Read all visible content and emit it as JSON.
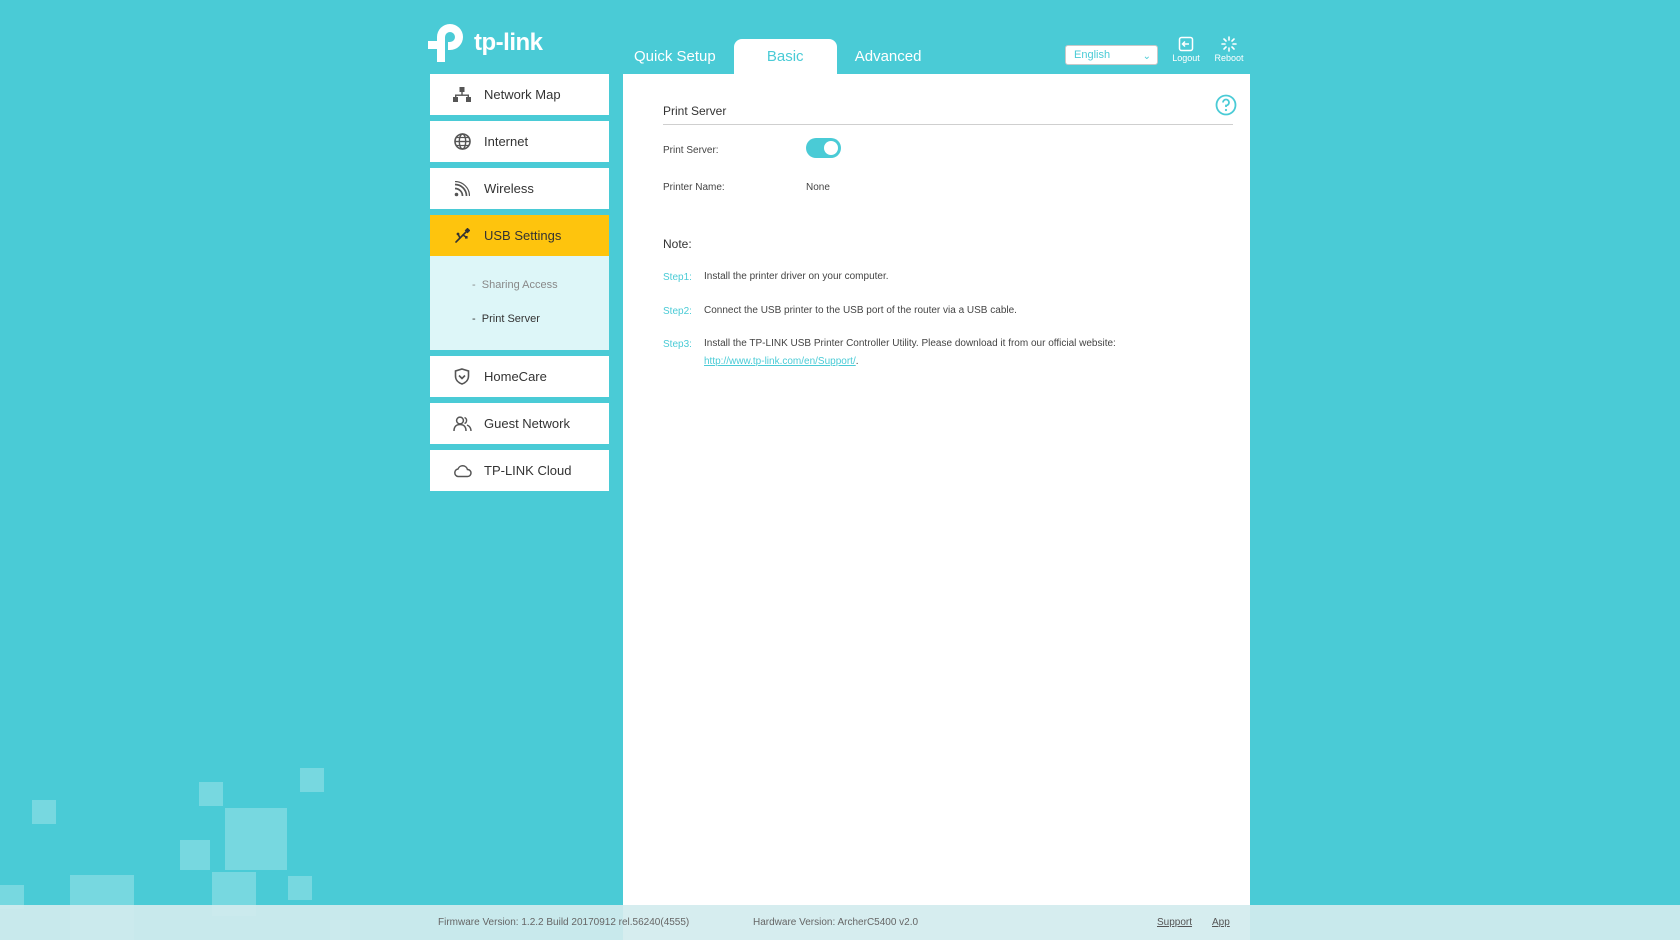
{
  "brand": {
    "logo_text": "tp-link"
  },
  "nav": {
    "tabs": [
      {
        "label": "Quick Setup"
      },
      {
        "label": "Basic"
      },
      {
        "label": "Advanced"
      }
    ]
  },
  "header": {
    "language": "English",
    "logout_label": "Logout",
    "reboot_label": "Reboot"
  },
  "sidebar": {
    "items": [
      {
        "label": "Network Map",
        "icon": "network-map-icon"
      },
      {
        "label": "Internet",
        "icon": "globe-icon"
      },
      {
        "label": "Wireless",
        "icon": "wireless-icon"
      },
      {
        "label": "USB Settings",
        "icon": "usb-icon"
      },
      {
        "label": "HomeCare",
        "icon": "shield-icon"
      },
      {
        "label": "Guest Network",
        "icon": "guest-icon"
      },
      {
        "label": "TP-LINK Cloud",
        "icon": "cloud-icon"
      }
    ],
    "submenu": [
      {
        "label": "Sharing Access"
      },
      {
        "label": "Print Server"
      }
    ]
  },
  "content": {
    "section_title": "Print Server",
    "print_server_label": "Print Server:",
    "print_server_enabled": true,
    "printer_name_label": "Printer Name:",
    "printer_name_value": "None",
    "note_title": "Note:",
    "steps": [
      {
        "label": "Step1:",
        "text": "Install the printer driver on your computer."
      },
      {
        "label": "Step2:",
        "text": "Connect the USB printer to the USB port of the router via a USB cable."
      },
      {
        "label": "Step3:",
        "text": "Install the TP-LINK USB Printer Controller Utility. Please download it from our official website:",
        "link": "http://www.tp-link.com/en/Support/",
        "suffix": "."
      }
    ]
  },
  "footer": {
    "firmware": "Firmware Version: 1.2.2 Build 20170912 rel.56240(4555)",
    "hardware": "Hardware Version: ArcherC5400 v2.0",
    "support": "Support",
    "app": "App"
  },
  "colors": {
    "accent": "#4acbd6",
    "highlight": "#fec40d"
  }
}
